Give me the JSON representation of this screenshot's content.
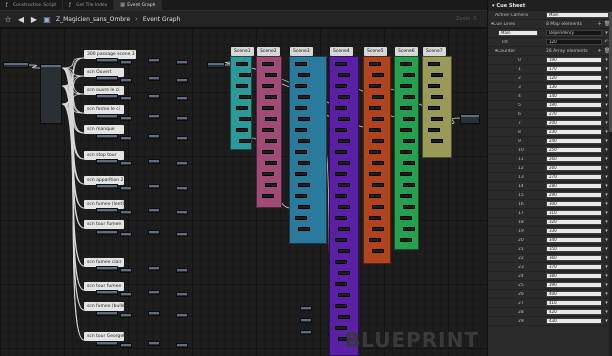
{
  "tabs": [
    {
      "label": "Construction Script",
      "icon": "function-icon",
      "active": false
    },
    {
      "label": "Get Tile Index",
      "icon": "function-icon",
      "active": false
    },
    {
      "label": "Event Graph",
      "icon": "graph-icon",
      "active": true
    }
  ],
  "breadcrumb": {
    "back_icon": "back-arrow-icon",
    "forward_icon": "forward-arrow-icon",
    "blueprint_icon": "blueprint-icon",
    "path": [
      "Z_Magicien_sans_Ombre",
      "Event Graph"
    ],
    "zoom": "Zoom -5"
  },
  "graph": {
    "watermark": "BLUEPRINT",
    "comments": [
      "300 passage scene 3",
      "scn Ouvert",
      "scn ouvre le ci",
      "scn ferme le ci",
      "scn manque",
      "scn stop tour",
      "scn apparition 2",
      "scn fumee (lent)",
      "scn tour fumee",
      "scn fumee clair",
      "scn tour fumee",
      "scn fumee (bulles)",
      "scn tour Georgette"
    ],
    "columns": [
      {
        "label": "Scene1",
        "color": "#2a9a9a"
      },
      {
        "label": "Scene2",
        "color": "#a04a78"
      },
      {
        "label": "Scene3",
        "color": "#2a7a9e"
      },
      {
        "label": "Scene4",
        "color": "#5a1fa4"
      },
      {
        "label": "Scene5",
        "color": "#b0441e"
      },
      {
        "label": "Scene6",
        "color": "#26a04e"
      },
      {
        "label": "Scene7",
        "color": "#9a9a58"
      }
    ]
  },
  "details": {
    "title": "Cue Sheet",
    "rows": [
      {
        "label": "Active Camera",
        "value": "Main"
      },
      {
        "label": "Cue Lines",
        "value": "8 Map elements",
        "section": true
      }
    ],
    "map_key": "Main",
    "map_value": "Dependency",
    "sub_label": "Int",
    "sub_value": "120",
    "counter_label": "Counter",
    "counter_value": "28 Array elements",
    "elements": [
      {
        "index": "0",
        "value": "190"
      },
      {
        "index": "1",
        "value": "170"
      },
      {
        "index": "2",
        "value": "120"
      },
      {
        "index": "3",
        "value": "130"
      },
      {
        "index": "4",
        "value": "140"
      },
      {
        "index": "5",
        "value": "190"
      },
      {
        "index": "6",
        "value": "270"
      },
      {
        "index": "7",
        "value": "200"
      },
      {
        "index": "8",
        "value": "230"
      },
      {
        "index": "9",
        "value": "240"
      },
      {
        "index": "10",
        "value": "250"
      },
      {
        "index": "11",
        "value": "260"
      },
      {
        "index": "12",
        "value": "260"
      },
      {
        "index": "13",
        "value": "270"
      },
      {
        "index": "14",
        "value": "280"
      },
      {
        "index": "15",
        "value": "290"
      },
      {
        "index": "16",
        "value": "300"
      },
      {
        "index": "17",
        "value": "310"
      },
      {
        "index": "18",
        "value": "320"
      },
      {
        "index": "19",
        "value": "330"
      },
      {
        "index": "20",
        "value": "340"
      },
      {
        "index": "21",
        "value": "350"
      },
      {
        "index": "22",
        "value": "360"
      },
      {
        "index": "23",
        "value": "370"
      },
      {
        "index": "24",
        "value": "380"
      },
      {
        "index": "25",
        "value": "390"
      },
      {
        "index": "26",
        "value": "400"
      },
      {
        "index": "27",
        "value": "410"
      },
      {
        "index": "28",
        "value": "420"
      },
      {
        "index": "29",
        "value": "430"
      }
    ]
  }
}
